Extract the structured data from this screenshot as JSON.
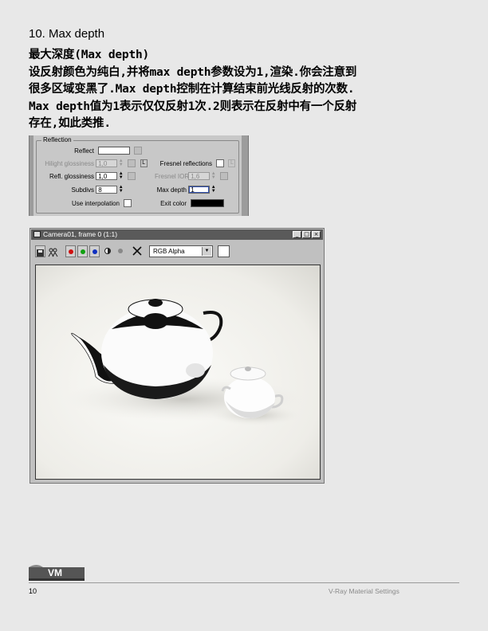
{
  "section": {
    "title": "10. Max depth"
  },
  "paragraph": {
    "lines": [
      "最大深度(Max depth)",
      "设反射颜色为纯白,并将max depth参数设为1,渲染.你会注意到",
      "很多区域变黑了.Max depth控制在计算结束前光线反射的次数.",
      "Max depth值为1表示仅仅反射1次.2则表示在反射中有一个反射",
      "存在,如此类推."
    ]
  },
  "reflection_panel": {
    "group_label": "Reflection",
    "reflect_label": "Reflect",
    "hilight_label": "Hilight glossiness",
    "hilight_value": "1,0",
    "refl_gloss_label": "Refl. glossiness",
    "refl_gloss_value": "1,0",
    "subdivs_label": "Subdivs",
    "subdivs_value": "8",
    "use_interp_label": "Use interpolation",
    "fresnel_label": "Fresnel reflections",
    "fresnel_ior_label": "Fresnel IOR",
    "fresnel_ior_value": "1,6",
    "max_depth_label": "Max depth",
    "max_depth_value": "1",
    "exit_color_label": "Exit color",
    "lock_label": "L",
    "reflect_color": "#ffffff",
    "exit_color": "#000000"
  },
  "render_window": {
    "title": "Camera01, frame 0 (1:1)",
    "minimize": "_",
    "maximize": "□",
    "close": "×",
    "channel": "RGB Alpha",
    "red_color": "#d01010",
    "green_color": "#10a010",
    "blue_color": "#1030c0"
  },
  "footer": {
    "logo_text": "VM",
    "page_number": "10",
    "title": "V-Ray Material Settings"
  }
}
